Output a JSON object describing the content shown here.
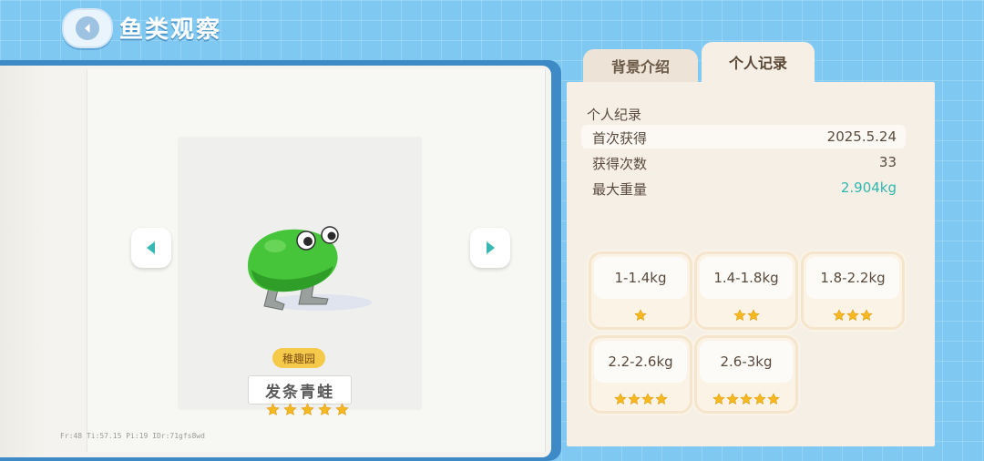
{
  "header": {
    "title": "鱼类观察"
  },
  "fish": {
    "habitat_tag": "稚趣园",
    "name": "发条青蛙",
    "star_rating": 5
  },
  "debug_overlay": "Fr:48  Ti:57.15  Pi:19  IDr:71gfs8wd",
  "tabs": [
    {
      "label": "背景介绍",
      "active": false
    },
    {
      "label": "个人记录",
      "active": true
    }
  ],
  "record": {
    "title": "个人纪录",
    "rows": [
      {
        "label": "首次获得",
        "value": "2025.5.24"
      },
      {
        "label": "获得次数",
        "value": "33"
      },
      {
        "label": "最大重量",
        "value": "2.904kg"
      }
    ]
  },
  "weight_tiers": [
    {
      "range": "1-1.4kg",
      "stars": 1
    },
    {
      "range": "1.4-1.8kg",
      "stars": 2
    },
    {
      "range": "1.8-2.2kg",
      "stars": 3
    },
    {
      "range": "2.2-2.6kg",
      "stars": 4
    },
    {
      "range": "2.6-3kg",
      "stars": 5
    }
  ],
  "colors": {
    "accent_teal": "#2fb8b0",
    "star_gold": "#f5b820",
    "sky": "#7fc8f2"
  }
}
